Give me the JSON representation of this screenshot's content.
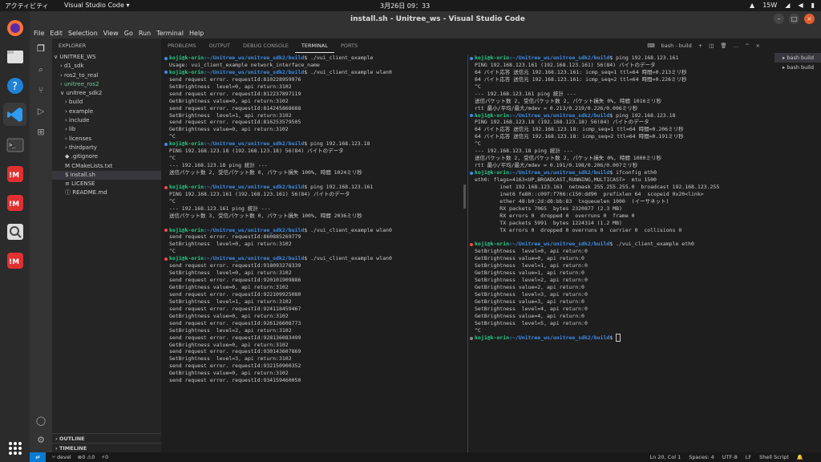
{
  "topbar": {
    "activities": "アクティビティ",
    "app": "Visual Studio Code ▾",
    "clock": "3月26日 09：33",
    "net": "15W"
  },
  "window": {
    "title": "install.sh - Unitree_ws - Visual Studio Code"
  },
  "menu": [
    "File",
    "Edit",
    "Selection",
    "View",
    "Go",
    "Run",
    "Terminal",
    "Help"
  ],
  "sidebar": {
    "header": "EXPLORER",
    "items": [
      {
        "label": "∨ UNITREE_WS",
        "cls": "",
        "indent": 2
      },
      {
        "label": "› d1_sdk",
        "cls": "",
        "indent": 10
      },
      {
        "label": "› ros2_to_real",
        "cls": "",
        "indent": 10
      },
      {
        "label": "› unitree_ros2",
        "cls": "grn",
        "indent": 10
      },
      {
        "label": "∨ unitree_sdk2",
        "cls": "",
        "indent": 10
      },
      {
        "label": "› build",
        "cls": "",
        "indent": 16
      },
      {
        "label": "› example",
        "cls": "",
        "indent": 16
      },
      {
        "label": "› include",
        "cls": "",
        "indent": 16
      },
      {
        "label": "› lib",
        "cls": "",
        "indent": 16
      },
      {
        "label": "› licenses",
        "cls": "",
        "indent": 16
      },
      {
        "label": "› thirdparty",
        "cls": "",
        "indent": 16
      },
      {
        "label": "◆ .gitignore",
        "cls": "",
        "indent": 16
      },
      {
        "label": "M CMakeLists.txt",
        "cls": "",
        "indent": 16
      },
      {
        "label": "$ install.sh",
        "cls": "active",
        "indent": 16
      },
      {
        "label": "≡ LICENSE",
        "cls": "",
        "indent": 16
      },
      {
        "label": "ⓘ README.md",
        "cls": "",
        "indent": 16
      }
    ],
    "outline": "› OUTLINE",
    "timeline": "› TIMELINE"
  },
  "panel": {
    "tabs": [
      "PROBLEMS",
      "OUTPUT",
      "DEBUG CONSOLE",
      "TERMINAL",
      "PORTS"
    ],
    "active_tab": "TERMINAL",
    "shell_label": "bash - build",
    "shells": [
      "bash build",
      "bash build"
    ]
  },
  "colors": {
    "prompt": "#23d18b",
    "path": "#3b8eea",
    "error_dot": "#f14c4c",
    "ok_dot": "#3b8eea"
  },
  "terminal_left": [
    {
      "t": "prompt",
      "c": "./vui_client_example",
      "d": "b"
    },
    {
      "t": "Usage: vui_client_example network_interface_name"
    },
    {
      "t": "prompt",
      "c": "./vui_client_example wlan0",
      "d": "b"
    },
    {
      "t": "send request error. requestId:810228959976"
    },
    {
      "t": "SetBrightness  level=0, api return:3102"
    },
    {
      "t": "send request error. requestId:812237897119"
    },
    {
      "t": "GetBrightness value=0, api return:3102"
    },
    {
      "t": "send request error. requestId:814245868688"
    },
    {
      "t": "SetBrightness  level=1, api return:3102"
    },
    {
      "t": "send request error. requestId:816253579505"
    },
    {
      "t": "GetBrightness value=0, api return:3102"
    },
    {
      "t": "^C"
    },
    {
      "t": "prompt",
      "c": "ping 192.168.123.18",
      "d": "b"
    },
    {
      "t": "PING 192.168.123.18 (192.168.123.18) 56(84) バイトのデータ"
    },
    {
      "t": "^C"
    },
    {
      "t": "--- 192.168.123.18 ping 統計 ---"
    },
    {
      "t": "送信パケット数 2, 受信パケット数 0, パケット損失 100%, 時間 1024ミリ秒"
    },
    {
      "t": ""
    },
    {
      "t": "prompt",
      "c": "ping 192.168.123.161",
      "d": "r"
    },
    {
      "t": "PING 192.168.123.161 (192.168.123.161) 56(84) バイトのデータ"
    },
    {
      "t": "^C"
    },
    {
      "t": "--- 192.168.123.161 ping 統計 ---"
    },
    {
      "t": "送信パケット数 3, 受信パケット数 0, パケット損失 100%, 時間 2036ミリ秒"
    },
    {
      "t": ""
    },
    {
      "t": "prompt",
      "c": "./vui_client_example wlan0",
      "d": "r"
    },
    {
      "t": "send request error. requestId:860885269779"
    },
    {
      "t": "SetBrightness  level=0, api return:3102"
    },
    {
      "t": "^C"
    },
    {
      "t": "prompt",
      "c": "./vui_client_example wlan0",
      "d": "r"
    },
    {
      "t": "send request error. requestId:918093278339"
    },
    {
      "t": "SetBrightness  level=0, api return:3102"
    },
    {
      "t": "send request error. requestId:920101909886"
    },
    {
      "t": "GetBrightness value=0, api return:3102"
    },
    {
      "t": "send request error. requestId:922109925080"
    },
    {
      "t": "SetBrightness  level=1, api return:3102"
    },
    {
      "t": "send request error. requestId:924118459467"
    },
    {
      "t": "GetBrightness value=0, api return:3102"
    },
    {
      "t": "send request error. requestId:926126608773"
    },
    {
      "t": "SetBrightness  level=2, api return:3102"
    },
    {
      "t": "send request error. requestId:928136083499"
    },
    {
      "t": "GetBrightness value=0, api return:3102"
    },
    {
      "t": "send request error. requestId:930143607869"
    },
    {
      "t": "SetBrightness  level=3, api return:3102"
    },
    {
      "t": "send request error. requestId:932150900352"
    },
    {
      "t": "GetBrightness value=0, api return:3102"
    },
    {
      "t": "send request error. requestId:934159460050"
    }
  ],
  "terminal_right": [
    {
      "t": "prompt",
      "c": "ping 192.168.123.161",
      "d": "b"
    },
    {
      "t": "PING 192.168.123.161 (192.168.123.161) 56(84) バイトのデータ"
    },
    {
      "t": "64 バイト応答 送信元 192.168.123.161: icmp_seq=1 ttl=64 時間=0.213ミリ秒"
    },
    {
      "t": "64 バイト応答 送信元 192.168.123.161: icmp_seq=2 ttl=64 時間=0.226ミリ秒"
    },
    {
      "t": "^C"
    },
    {
      "t": "--- 192.168.123.161 ping 統計 ---"
    },
    {
      "t": "送信パケット数 2, 受信パケット数 2, パケット損失 0%, 時間 1016ミリ秒"
    },
    {
      "t": "rtt 最小/平均/最大/mdev = 0.213/0.219/0.226/0.006ミリ秒"
    },
    {
      "t": "prompt",
      "c": "ping 192.168.123.18",
      "d": "b"
    },
    {
      "t": "PING 192.168.123.18 (192.168.123.18) 56(84) バイトのデータ"
    },
    {
      "t": "64 バイト応答 送信元 192.168.123.18: icmp_seq=1 ttl=64 時間=0.206ミリ秒"
    },
    {
      "t": "64 バイト応答 送信元 192.168.123.18: icmp_seq=2 ttl=64 時間=0.191ミリ秒"
    },
    {
      "t": "^C"
    },
    {
      "t": "--- 192.168.123.18 ping 統計 ---"
    },
    {
      "t": "送信パケット数 2, 受信パケット数 2, パケット損失 0%, 時間 1000ミリ秒"
    },
    {
      "t": "rtt 最小/平均/最大/mdev = 0.191/0.198/0.206/0.007ミリ秒"
    },
    {
      "t": "prompt",
      "c": "ifconfig eth0",
      "d": "b"
    },
    {
      "t": "eth0: flags=4163<UP,BROADCAST,RUNNING,MULTICAST>  mtu 1500"
    },
    {
      "t": "        inet 192.168.123.163  netmask 255.255.255.0  broadcast 192.168.123.255"
    },
    {
      "t": "        inet6 fe80::c09f:f706:c150:dd90  prefixlen 64  scopeid 0x20<link>"
    },
    {
      "t": "        ether 48:b0:2d:d8:bb:83  txqueuelen 1000  (イーサネット)"
    },
    {
      "t": "        RX packets 7065  bytes 2320877 (2.3 MB)"
    },
    {
      "t": "        RX errors 0  dropped 0  overruns 0  frame 0"
    },
    {
      "t": "        TX packets 5991  bytes 1224314 (1.2 MB)"
    },
    {
      "t": "        TX errors 0  dropped 0 overruns 0  carrier 0  collisions 0"
    },
    {
      "t": ""
    },
    {
      "t": "prompt",
      "c": "./vui_client_example eth0",
      "d": "r"
    },
    {
      "t": "SetBrightness  level=0, api return:0"
    },
    {
      "t": "GetBrightness value=0, api return:0"
    },
    {
      "t": "SetBrightness  level=1, api return:0"
    },
    {
      "t": "GetBrightness value=1, api return:0"
    },
    {
      "t": "SetBrightness  level=2, api return:0"
    },
    {
      "t": "GetBrightness value=2, api return:0"
    },
    {
      "t": "SetBrightness  level=3, api return:0"
    },
    {
      "t": "GetBrightness value=3, api return:0"
    },
    {
      "t": "SetBrightness  level=4, api return:0"
    },
    {
      "t": "GetBrightness value=4, api return:0"
    },
    {
      "t": "SetBrightness  level=5, api return:0"
    },
    {
      "t": "^C"
    },
    {
      "t": "prompt",
      "c": "",
      "d": "g"
    }
  ],
  "prompt": {
    "user": "koji@k-orin",
    "path": ":~/Unitree_ws/unitree_sdk2/build",
    "sym": "$ "
  },
  "status": {
    "left": [
      "⑂ devel",
      "⊗0 ⚠0",
      "⚡0"
    ],
    "right": [
      "Ln 20, Col 1",
      "Spaces: 4",
      "UTF-8",
      "LF",
      "Shell Script",
      "🔔"
    ]
  }
}
